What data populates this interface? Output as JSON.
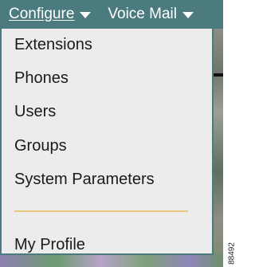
{
  "menubar": {
    "configure_label": "Configure",
    "voicemail_label": "Voice Mail",
    "configure_icon": "chevron-down-icon",
    "voicemail_icon": "chevron-down-icon",
    "background_color": "#4c7b7f"
  },
  "dropdown": {
    "items": [
      {
        "label": "Extensions"
      },
      {
        "label": "Phones"
      },
      {
        "label": "Users"
      },
      {
        "label": "Groups"
      },
      {
        "label": "System Parameters"
      },
      {
        "label": "My Profile"
      }
    ],
    "separator_color": "#e8c77a"
  },
  "figure_number": "88492"
}
